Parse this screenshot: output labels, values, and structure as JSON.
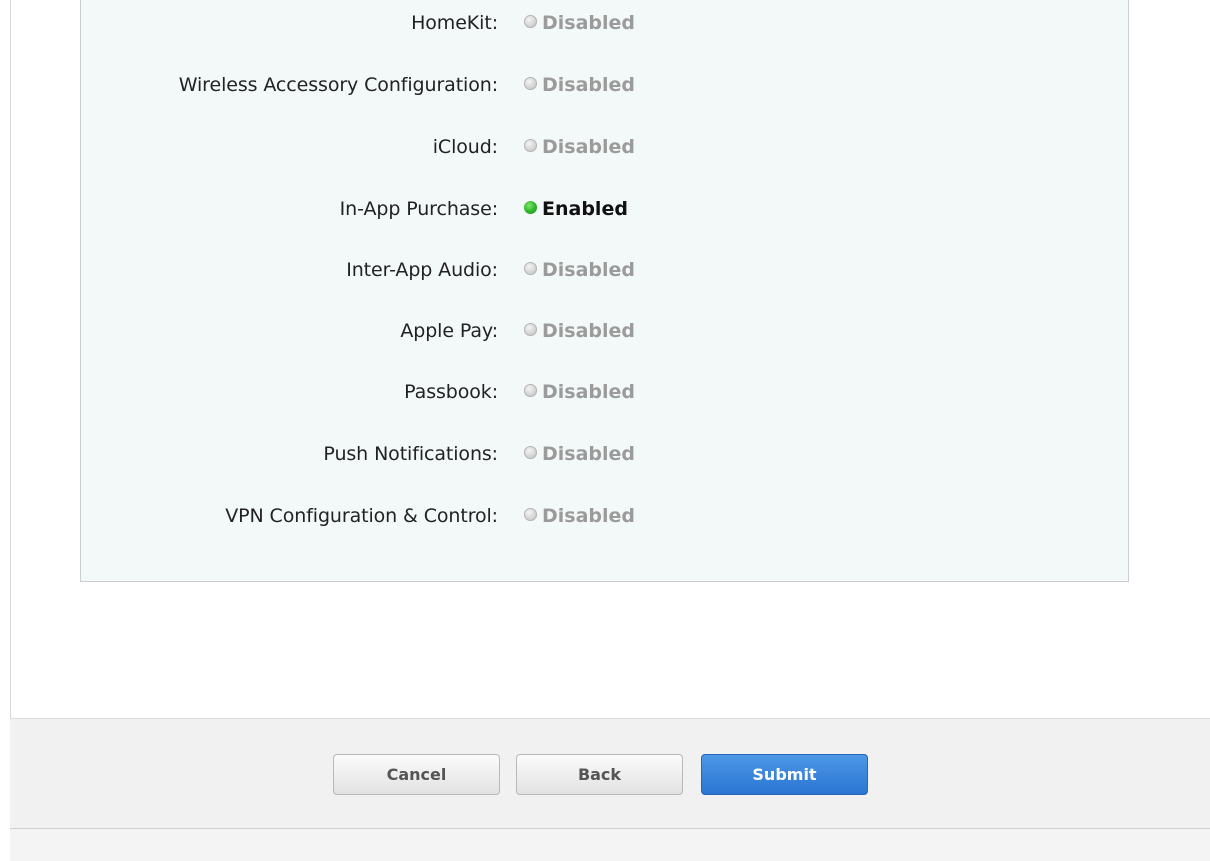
{
  "services": [
    {
      "label": "HomeKit:",
      "status": "Disabled",
      "enabled": false
    },
    {
      "label": "Wireless Accessory Configuration:",
      "status": "Disabled",
      "enabled": false
    },
    {
      "label": "iCloud:",
      "status": "Disabled",
      "enabled": false
    },
    {
      "label": "In-App Purchase:",
      "status": "Enabled",
      "enabled": true
    },
    {
      "label": "Inter-App Audio:",
      "status": "Disabled",
      "enabled": false
    },
    {
      "label": "Apple Pay:",
      "status": "Disabled",
      "enabled": false
    },
    {
      "label": "Passbook:",
      "status": "Disabled",
      "enabled": false
    },
    {
      "label": "Push Notifications:",
      "status": "Disabled",
      "enabled": false
    },
    {
      "label": "VPN Configuration & Control:",
      "status": "Disabled",
      "enabled": false
    }
  ],
  "footer": {
    "cancel_label": "Cancel",
    "back_label": "Back",
    "submit_label": "Submit"
  },
  "colors": {
    "panel_background": "#f3f8f8",
    "enabled_dot": "#2ab42a",
    "disabled_text": "#9b9b9b",
    "primary_button": "#2a76d2"
  }
}
